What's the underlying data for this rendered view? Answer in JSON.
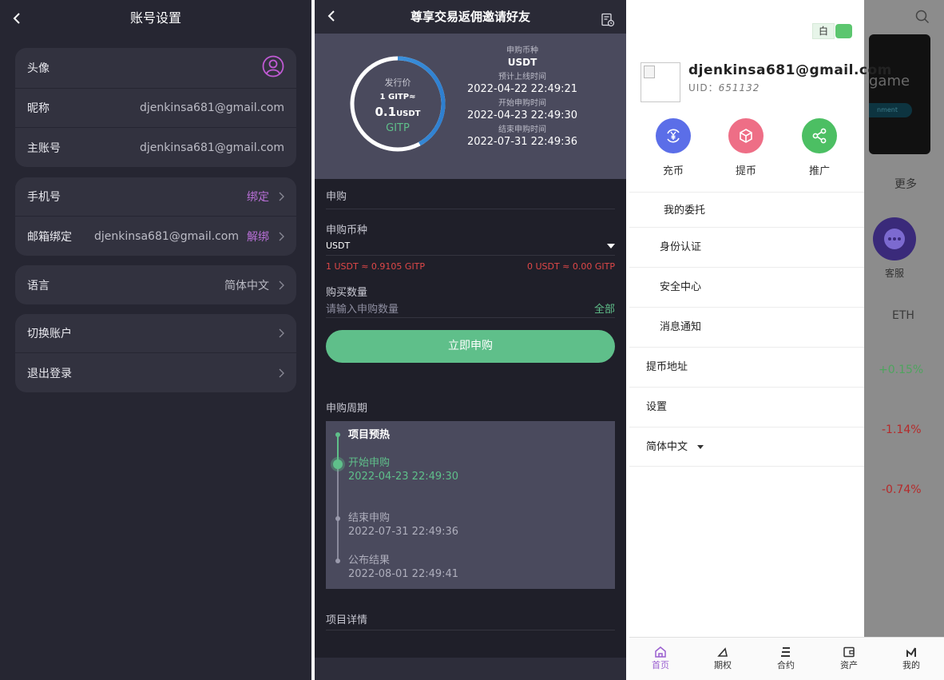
{
  "account": {
    "title": "账号设置",
    "rows": [
      {
        "label": "头像"
      },
      {
        "label": "昵称",
        "value": "djenkinsa681@gmail.com"
      },
      {
        "label": "主账号",
        "value": "djenkinsa681@gmail.com"
      },
      {
        "label": "手机号",
        "link": "绑定"
      },
      {
        "label": "邮箱绑定",
        "value": "djenkinsa681@gmail.com",
        "link": "解绑"
      },
      {
        "label": "语言",
        "value": "简体中文"
      },
      {
        "label": "切换账户"
      },
      {
        "label": "退出登录"
      }
    ]
  },
  "subscribe": {
    "title": "尊享交易返佣邀请好友",
    "ring": {
      "label": "发行价",
      "rate": "1 GITP≈",
      "price": "0.1",
      "price_unit": "USDT",
      "coin": "GITP",
      "progress": 0.42
    },
    "info": [
      {
        "label": "申购币种",
        "value": "USDT"
      },
      {
        "label": "预计上线时间",
        "value": "2022-04-22 22:49:21"
      },
      {
        "label": "开始申购时间",
        "value": "2022-04-23 22:49:30"
      },
      {
        "label": "结束申购时间",
        "value": "2022-07-31 22:49:36"
      }
    ],
    "section_title": "申购",
    "coin_label": "申购币种",
    "coin_value": "USDT",
    "rate_left": "1 USDT ≈ 0.9105 GITP",
    "rate_right": "0 USDT ≈ 0.00 GITP",
    "qty_label": "购买数量",
    "qty_placeholder": "请输入申购数量",
    "qty_all": "全部",
    "submit": "立即申购",
    "cycle_title": "申购周期",
    "timeline": [
      {
        "title": "项目预热",
        "time": ""
      },
      {
        "title": "开始申购",
        "time": "2022-04-23 22:49:30"
      },
      {
        "title": "结束申购",
        "time": "2022-07-31 22:49:36"
      },
      {
        "title": "公布结果",
        "time": "2022-08-01 22:49:41"
      }
    ],
    "detail_title": "项目详情"
  },
  "drawer": {
    "theme_label": "白",
    "email": "djenkinsa681@gmail.com",
    "uid_label": "UID：",
    "uid": "651132",
    "quick": [
      {
        "label": "充币",
        "icon": "yen-exchange-icon",
        "color": "#5b6ee8"
      },
      {
        "label": "提币",
        "icon": "box-icon",
        "color": "#ee6e86"
      },
      {
        "label": "推广",
        "icon": "share-icon",
        "color": "#4cbf63"
      }
    ],
    "menu": [
      "我的委托",
      "身份认证",
      "安全中心",
      "消息通知",
      "提币地址",
      "设置",
      "简体中文"
    ]
  },
  "background_app": {
    "banner_text": "game",
    "banner_pill": "nment",
    "more": "更多",
    "kefu": "客服",
    "eth": "ETH",
    "changes": [
      "+0.15%",
      "-1.14%",
      "-0.74%"
    ]
  },
  "tabbar": [
    "首页",
    "期权",
    "合约",
    "资产",
    "我的"
  ],
  "colors": {
    "accent_green": "#5fbf8a",
    "accent_purple": "#b86fd6",
    "down_red": "#e04848"
  }
}
